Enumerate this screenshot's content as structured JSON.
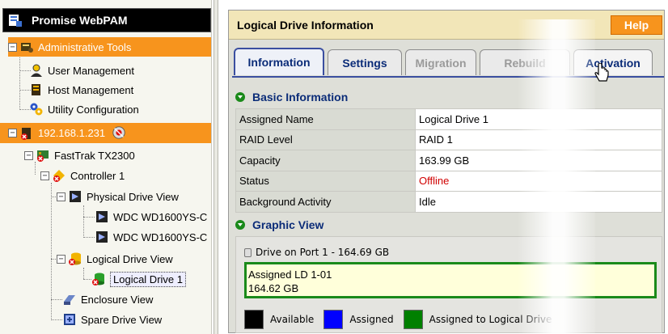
{
  "tree": {
    "title": "Promise WebPAM",
    "items": [
      {
        "label": "Administrative Tools"
      },
      {
        "label": "User Management"
      },
      {
        "label": "Host Management"
      },
      {
        "label": "Utility Configuration"
      },
      {
        "label": "192.168.1.231"
      },
      {
        "label": "FastTrak TX2300"
      },
      {
        "label": "Controller 1"
      },
      {
        "label": "Physical Drive View"
      },
      {
        "label": "WDC WD1600YS-C"
      },
      {
        "label": "WDC WD1600YS-C"
      },
      {
        "label": "Logical Drive View"
      },
      {
        "label": "Logical Drive 1"
      },
      {
        "label": "Enclosure View"
      },
      {
        "label": "Spare Drive View"
      }
    ]
  },
  "panel": {
    "title": "Logical Drive Information",
    "help_label": "Help",
    "tabs": [
      {
        "label": "Information",
        "state": "active"
      },
      {
        "label": "Settings",
        "state": "enabled"
      },
      {
        "label": "Migration",
        "state": "disabled"
      },
      {
        "label": "Rebuild",
        "state": "disabled"
      },
      {
        "label": "Activation",
        "state": "hover"
      }
    ],
    "basic_section": "Basic Information",
    "rows": [
      {
        "key": "Assigned Name",
        "value": "Logical Drive 1"
      },
      {
        "key": "RAID Level",
        "value": "RAID 1"
      },
      {
        "key": "Capacity",
        "value": "163.99 GB"
      },
      {
        "key": "Status",
        "value": "Offline"
      },
      {
        "key": "Background Activity",
        "value": "Idle"
      }
    ],
    "graphic_section": "Graphic View",
    "drive_label": "Drive on Port 1 - 164.69 GB",
    "ld_line1": "Assigned LD 1-01",
    "ld_line2": "164.62 GB",
    "legend": [
      {
        "label": "Available",
        "color": "#000000"
      },
      {
        "label": "Assigned",
        "color": "#0000ff"
      },
      {
        "label": "Assigned to Logical Drive",
        "color": "#008000"
      }
    ]
  },
  "colors": {
    "highlight": "#f7941d",
    "header_bg": "#f2e6b8",
    "tab_blue": "#0b2c78",
    "offline_red": "#d00000"
  }
}
